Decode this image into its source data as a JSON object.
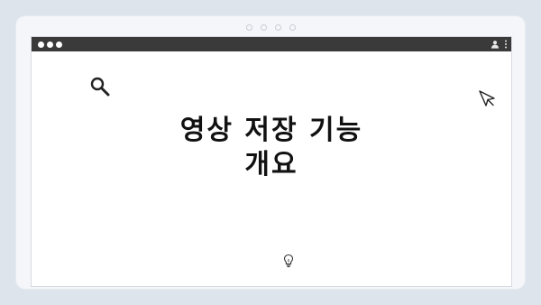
{
  "title": {
    "line1": "영상 저장 기능",
    "line2": "개요"
  },
  "icons": {
    "search": "search-icon",
    "cursor": "cursor-icon",
    "profile": "profile-icon",
    "menu": "kebab-menu-icon",
    "bulb": "lightbulb-icon"
  },
  "colors": {
    "background": "#dde4ec",
    "titlebar": "#3a3a3a",
    "window": "#ffffff",
    "text": "#111111"
  }
}
